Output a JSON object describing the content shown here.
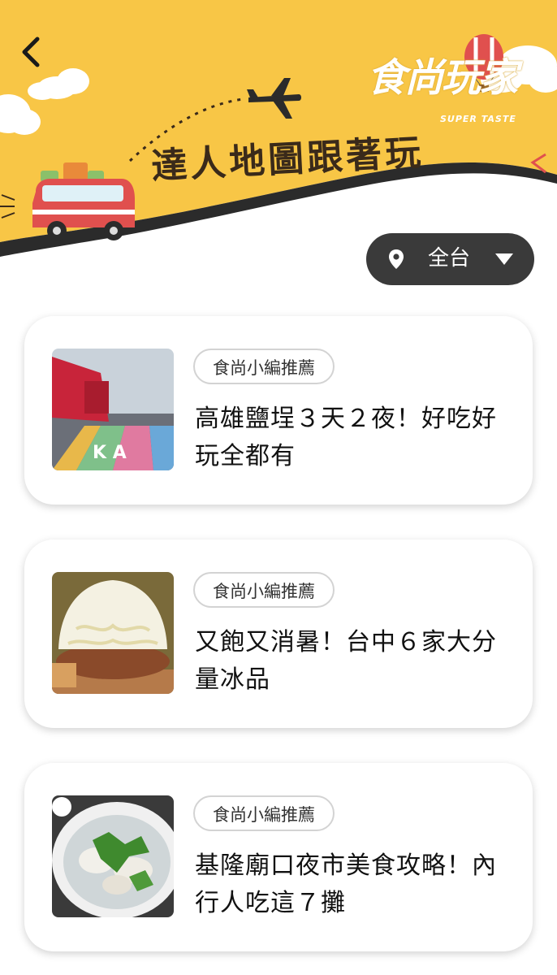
{
  "header": {
    "banner_title": "達人地圖跟著玩",
    "logo_text": "食尚玩家",
    "logo_sub": "SUPER TASTE"
  },
  "filter": {
    "region_label": "全台",
    "icon": "location-pin-icon"
  },
  "cards": [
    {
      "tag": "食尚小編推薦",
      "title": "高雄鹽埕３天２夜！好吃好玩全都有"
    },
    {
      "tag": "食尚小編推薦",
      "title": "又飽又消暑！台中６家大分量冰品"
    },
    {
      "tag": "食尚小編推薦",
      "title": "基隆廟口夜市美食攻略！內行人吃這７攤"
    }
  ],
  "colors": {
    "banner_yellow": "#f8c646",
    "dark_band": "#2b2b2b",
    "region_button": "#3a3a3a",
    "van_red": "#e0504e"
  }
}
